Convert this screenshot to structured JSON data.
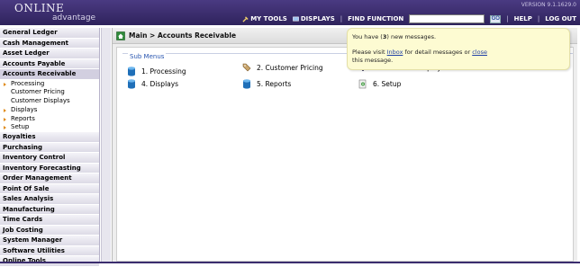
{
  "app": {
    "logo_online": "ONLINE",
    "logo_advantage": "advantage",
    "version": "VERSION 9.1.1629.0"
  },
  "toolbar": {
    "my_tools": "MY TOOLS",
    "displays": "DISPLAYS",
    "find_function": "FIND FUNCTION",
    "search_value": "",
    "go": "GO",
    "help": "HELP",
    "log_out": "LOG OUT",
    "separator": "|"
  },
  "sidebar": {
    "top_items": [
      {
        "label": "General Ledger"
      },
      {
        "label": "Cash Management"
      },
      {
        "label": "Asset Ledger"
      },
      {
        "label": "Accounts Payable"
      },
      {
        "label": "Accounts Receivable"
      }
    ],
    "sub_items": [
      {
        "label": "Processing"
      },
      {
        "label": "Customer Pricing"
      },
      {
        "label": "Customer Displays"
      },
      {
        "label": "Displays"
      },
      {
        "label": "Reports"
      },
      {
        "label": "Setup"
      }
    ],
    "bottom_items": [
      {
        "label": "Royalties"
      },
      {
        "label": "Purchasing"
      },
      {
        "label": "Inventory Control"
      },
      {
        "label": "Inventory Forecasting"
      },
      {
        "label": "Order Management"
      },
      {
        "label": "Point Of Sale"
      },
      {
        "label": "Sales Analysis"
      },
      {
        "label": "Manufacturing"
      },
      {
        "label": "Time Cards"
      },
      {
        "label": "Job Costing"
      },
      {
        "label": "System Manager"
      },
      {
        "label": "Software Utilities"
      },
      {
        "label": "Online Tools"
      }
    ]
  },
  "main": {
    "breadcrumb": "Main > Accounts Receivable",
    "sub_menus_legend": "Sub Menus",
    "links": [
      {
        "label": "1. Processing",
        "icon": "database-icon"
      },
      {
        "label": "2. Customer Pricing",
        "icon": "price-tag-icon"
      },
      {
        "label": "3. Customer Displays",
        "icon": "display-icon"
      },
      {
        "label": "4. Displays",
        "icon": "database-icon"
      },
      {
        "label": "5. Reports",
        "icon": "database-icon"
      },
      {
        "label": "6. Setup",
        "icon": "setup-icon"
      }
    ]
  },
  "popup": {
    "line1_pre": "You have (",
    "line1_count": "3",
    "line1_post": ") new messages.",
    "line2_pre": "Please visit ",
    "line2_link": "Inbox",
    "line2_mid": " for detail messages or ",
    "line2_close": "close",
    "line3": "this message."
  },
  "colors": {
    "header_bg": "#3b2d6e",
    "popup_bg": "#fdfbd2",
    "link": "#1f3fa6"
  }
}
